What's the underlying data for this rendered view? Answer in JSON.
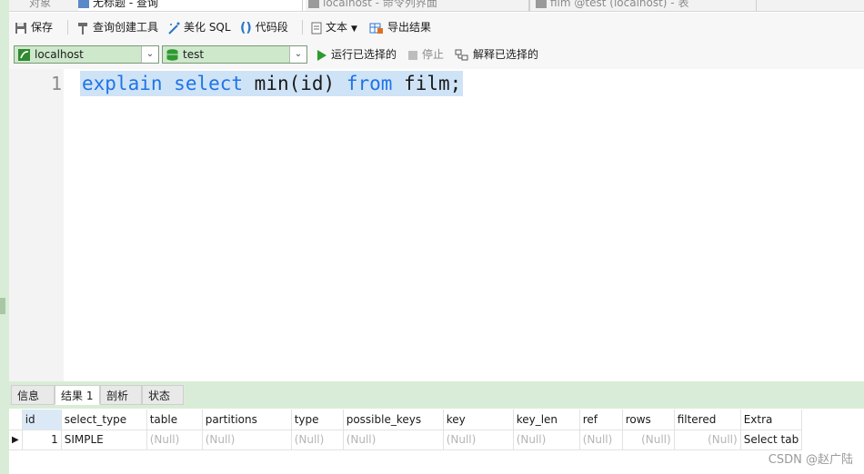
{
  "tabs": [
    {
      "label": "对象",
      "active": false
    },
    {
      "label": "无标题 - 查询",
      "active": true
    },
    {
      "label": "localhost - 命令列界面",
      "active": false
    },
    {
      "label": "film @test (localhost) - 表",
      "active": false
    }
  ],
  "toolbar": {
    "save": "保存",
    "query_builder": "查询创建工具",
    "beautify": "美化 SQL",
    "snippet": "代码段",
    "text": "文本",
    "export": "导出结果"
  },
  "connection": {
    "server": "localhost",
    "database": "test",
    "run_selected": "运行已选择的",
    "stop": "停止",
    "explain_selected": "解释已选择的"
  },
  "editor": {
    "line_number": "1",
    "tokens": [
      {
        "text": "explain",
        "kind": "kw"
      },
      {
        "text": " ",
        "kind": "tx"
      },
      {
        "text": "select",
        "kind": "kw"
      },
      {
        "text": " min(id) ",
        "kind": "tx"
      },
      {
        "text": "from",
        "kind": "kw"
      },
      {
        "text": " film;",
        "kind": "tx"
      }
    ]
  },
  "result_tabs": [
    "信息",
    "结果 1",
    "剖析",
    "状态"
  ],
  "result_active": "结果 1",
  "grid": {
    "columns": [
      "id",
      "select_type",
      "table",
      "partitions",
      "type",
      "possible_keys",
      "key",
      "key_len",
      "ref",
      "rows",
      "filtered",
      "Extra"
    ],
    "rows": [
      [
        "1",
        "SIMPLE",
        "(Null)",
        "(Null)",
        "(Null)",
        "(Null)",
        "(Null)",
        "(Null)",
        "(Null)",
        "(Null)",
        "(Null)",
        "Select tab"
      ]
    ]
  },
  "watermark": "CSDN @赵广陆",
  "colors": {
    "keyword": "#1f74e6",
    "selection": "#cfe3f7",
    "panel_green": "#d9ecd7"
  }
}
